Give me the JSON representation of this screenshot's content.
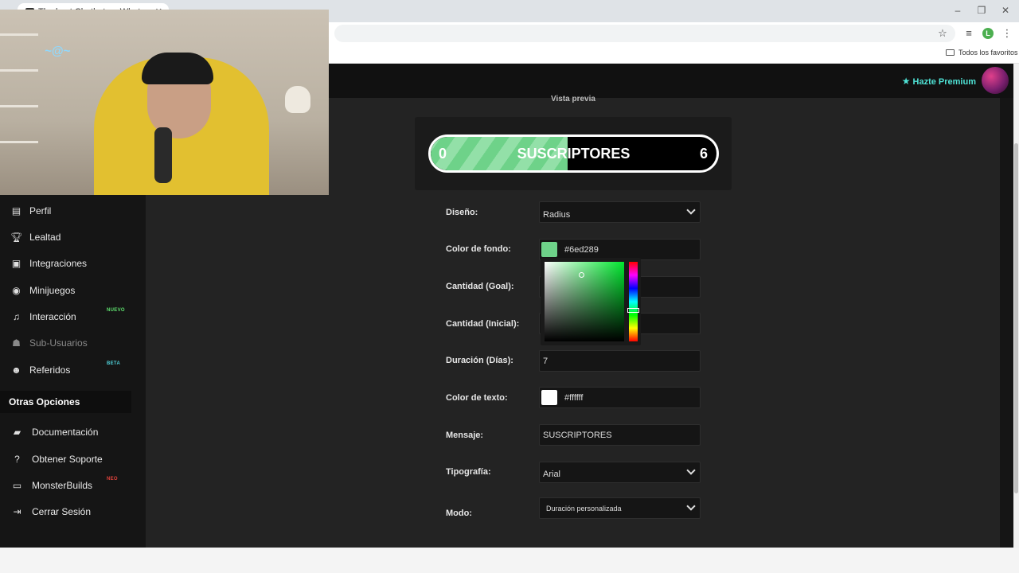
{
  "browser": {
    "tab_title": "The best Chatbot on Whatsapp",
    "bookmarks_all_label": "Todos los favoritos",
    "profile_initial": "L"
  },
  "header": {
    "premium_label": "Hazte Premium"
  },
  "sidebar": {
    "items": [
      {
        "label": "Perfil",
        "icon": "id-card-icon"
      },
      {
        "label": "Lealtad",
        "icon": "trophy-icon"
      },
      {
        "label": "Integraciones",
        "icon": "chat-icon"
      },
      {
        "label": "Minijuegos",
        "icon": "gamepad-icon"
      },
      {
        "label": "Interacción",
        "icon": "music-note-icon",
        "badge": "NUEVO"
      },
      {
        "label": "Sub-Usuarios",
        "icon": "users-icon"
      },
      {
        "label": "Referidos",
        "icon": "user-friends-icon",
        "badge": "BETA"
      }
    ],
    "section_title": "Otras Opciones",
    "other_items": [
      {
        "label": "Documentación",
        "icon": "book-icon"
      },
      {
        "label": "Obtener Soporte",
        "icon": "question-circle-icon"
      },
      {
        "label": "MonsterBuilds",
        "icon": "laptop-icon",
        "badge": "NEO"
      },
      {
        "label": "Cerrar Sesión",
        "icon": "sign-out-icon"
      }
    ]
  },
  "preview": {
    "label": "Vista previa",
    "start": "0",
    "message": "SUSCRIPTORES",
    "goal": "6",
    "progress_fraction": 0.48,
    "fill_color": "#6ed289"
  },
  "form": {
    "diseno": {
      "label": "Diseño:",
      "value": "Radius"
    },
    "color_fondo": {
      "label": "Color de fondo:",
      "value": "#6ed289"
    },
    "cantidad_goal": {
      "label": "Cantidad (Goal):"
    },
    "cantidad_inicial": {
      "label": "Cantidad (Inicial):"
    },
    "duracion": {
      "label": "Duración (Días):",
      "value": "7"
    },
    "color_texto": {
      "label": "Color de texto:",
      "value": "#ffffff"
    },
    "mensaje": {
      "label": "Mensaje:",
      "value": "SUSCRIPTORES"
    },
    "tipografia": {
      "label": "Tipografía:",
      "value": "Arial"
    },
    "modo": {
      "label": "Modo:",
      "value": "Duración personalizada"
    }
  },
  "colors": {
    "accent_teal": "#4fe3d6",
    "badge_green": "#5ee06e",
    "badge_teal": "#4fd1d9",
    "badge_red": "#e0423b"
  }
}
